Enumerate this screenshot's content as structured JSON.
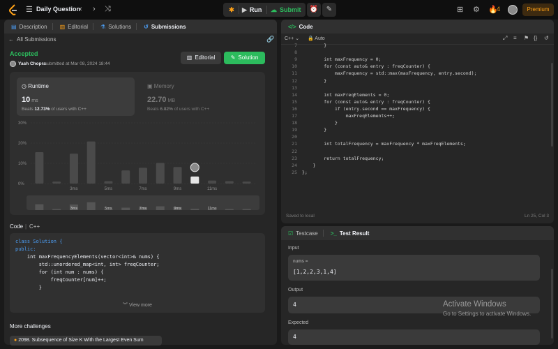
{
  "topbar": {
    "title": "Daily Question",
    "run_label": "Run",
    "submit_label": "Submit",
    "streak": "4",
    "premium_label": "Premium"
  },
  "left_panel": {
    "tabs": [
      "Description",
      "Editorial",
      "Solutions",
      "Submissions"
    ],
    "back_label": "All Submissions",
    "status": "Accepted",
    "author": "Yash Chopra",
    "submitted_text": "submitted at Mar 08, 2024 18:44",
    "editorial_btn": "Editorial",
    "solution_btn": "Solution",
    "runtime": {
      "label": "Runtime",
      "value": "10",
      "unit": "ms",
      "beats_pre": "Beats",
      "beats_pct": "12.73%",
      "beats_post": "of users with C++"
    },
    "memory": {
      "label": "Memory",
      "value": "22.70",
      "unit": "MB",
      "beats_pre": "Beats",
      "beats_pct": "6.82%",
      "beats_post": "of users with C++"
    },
    "code_header": "Code",
    "code_lang": "C++",
    "code_lines": [
      "class Solution {",
      "public:",
      "    int maxFrequencyElements(vector<int>& nums) {",
      "        std::unordered_map<int, int> freqCounter;",
      "        for (int num : nums) {",
      "            freqCounter[num]++;",
      "        }"
    ],
    "view_more": "View more",
    "more_challenges": "More challenges",
    "challenge_item": "2098. Subsequence of Size K With the Largest Even Sum"
  },
  "chart_data": {
    "type": "bar",
    "y_ticks": [
      "30%",
      "20%",
      "10%",
      "0%"
    ],
    "ylim": [
      0,
      30
    ],
    "x_tick_labels": [
      "3ms",
      "5ms",
      "7ms",
      "9ms",
      "11ms"
    ],
    "x": [
      1,
      2,
      3,
      4,
      5,
      6,
      7,
      8,
      9,
      10,
      11,
      12,
      13
    ],
    "values": [
      15.5,
      1,
      14.8,
      20.8,
      1.2,
      6.5,
      7.8,
      10.2,
      8.2,
      3.5,
      1.5,
      1.2,
      1
    ],
    "highlight_index": 9,
    "grid": true
  },
  "editor": {
    "title": "Code",
    "lang": "C++",
    "mode": "Auto",
    "lines": [
      {
        "n": "7",
        "t": "        }"
      },
      {
        "n": "8",
        "t": ""
      },
      {
        "n": "9",
        "t": "        int maxFrequency = 0;"
      },
      {
        "n": "10",
        "t": "        for (const auto& entry : freqCounter) {"
      },
      {
        "n": "11",
        "t": "            maxFrequency = std::max(maxFrequency, entry.second);"
      },
      {
        "n": "12",
        "t": "        }"
      },
      {
        "n": "13",
        "t": ""
      },
      {
        "n": "14",
        "t": "        int maxFreqElements = 0;"
      },
      {
        "n": "15",
        "t": "        for (const auto& entry : freqCounter) {"
      },
      {
        "n": "16",
        "t": "            if (entry.second == maxFrequency) {"
      },
      {
        "n": "17",
        "t": "                maxFreqElements++;"
      },
      {
        "n": "18",
        "t": "            }"
      },
      {
        "n": "19",
        "t": "        }"
      },
      {
        "n": "20",
        "t": ""
      },
      {
        "n": "21",
        "t": "        int totalFrequency = maxFrequency * maxFreqElements;"
      },
      {
        "n": "22",
        "t": ""
      },
      {
        "n": "23",
        "t": "        return totalFrequency;"
      },
      {
        "n": "24",
        "t": "    }"
      },
      {
        "n": "25",
        "t": "};"
      }
    ],
    "saved": "Saved to local",
    "cursor": "Ln 25, Col 3"
  },
  "testpanel": {
    "tab_testcase": "Testcase",
    "tab_result": "Test Result",
    "input_label": "Input",
    "var_label": "nums =",
    "input_value": "[1,2,2,3,1,4]",
    "output_label": "Output",
    "output_value": "4",
    "expected_label": "Expected",
    "expected_value": "4"
  },
  "watermark": {
    "title": "Activate Windows",
    "subtitle": "Go to Settings to activate Windows."
  }
}
